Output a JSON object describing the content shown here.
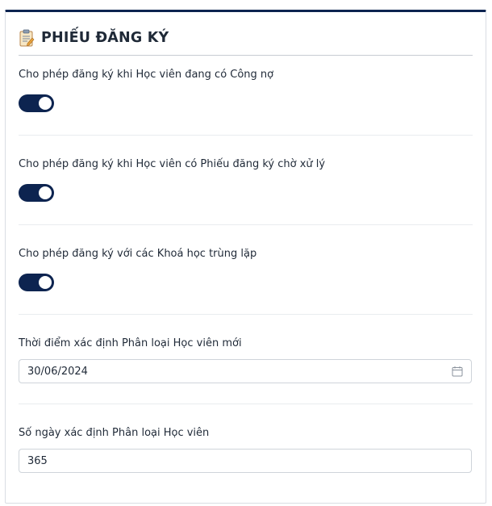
{
  "section": {
    "title": "PHIẾU ĐĂNG KÝ",
    "icon": "clipboard-icon"
  },
  "settings": [
    {
      "label": "Cho phép đăng ký khi Học viên đang có Công nợ",
      "type": "toggle",
      "enabled": true
    },
    {
      "label": "Cho phép đăng ký khi Học viên có Phiếu đăng ký chờ xử lý",
      "type": "toggle",
      "enabled": true
    },
    {
      "label": "Cho phép đăng ký với các Khoá học trùng lặp",
      "type": "toggle",
      "enabled": true
    },
    {
      "label": "Thời điểm xác định Phân loại Học viên mới",
      "type": "date",
      "value": "30/06/2024",
      "icon": "calendar-icon"
    },
    {
      "label": "Số ngày xác định Phân loại Học viên",
      "type": "number",
      "value": "365"
    }
  ],
  "colors": {
    "accent": "#0d2450",
    "border": "#cfd4da",
    "divider": "#e9ecef"
  }
}
